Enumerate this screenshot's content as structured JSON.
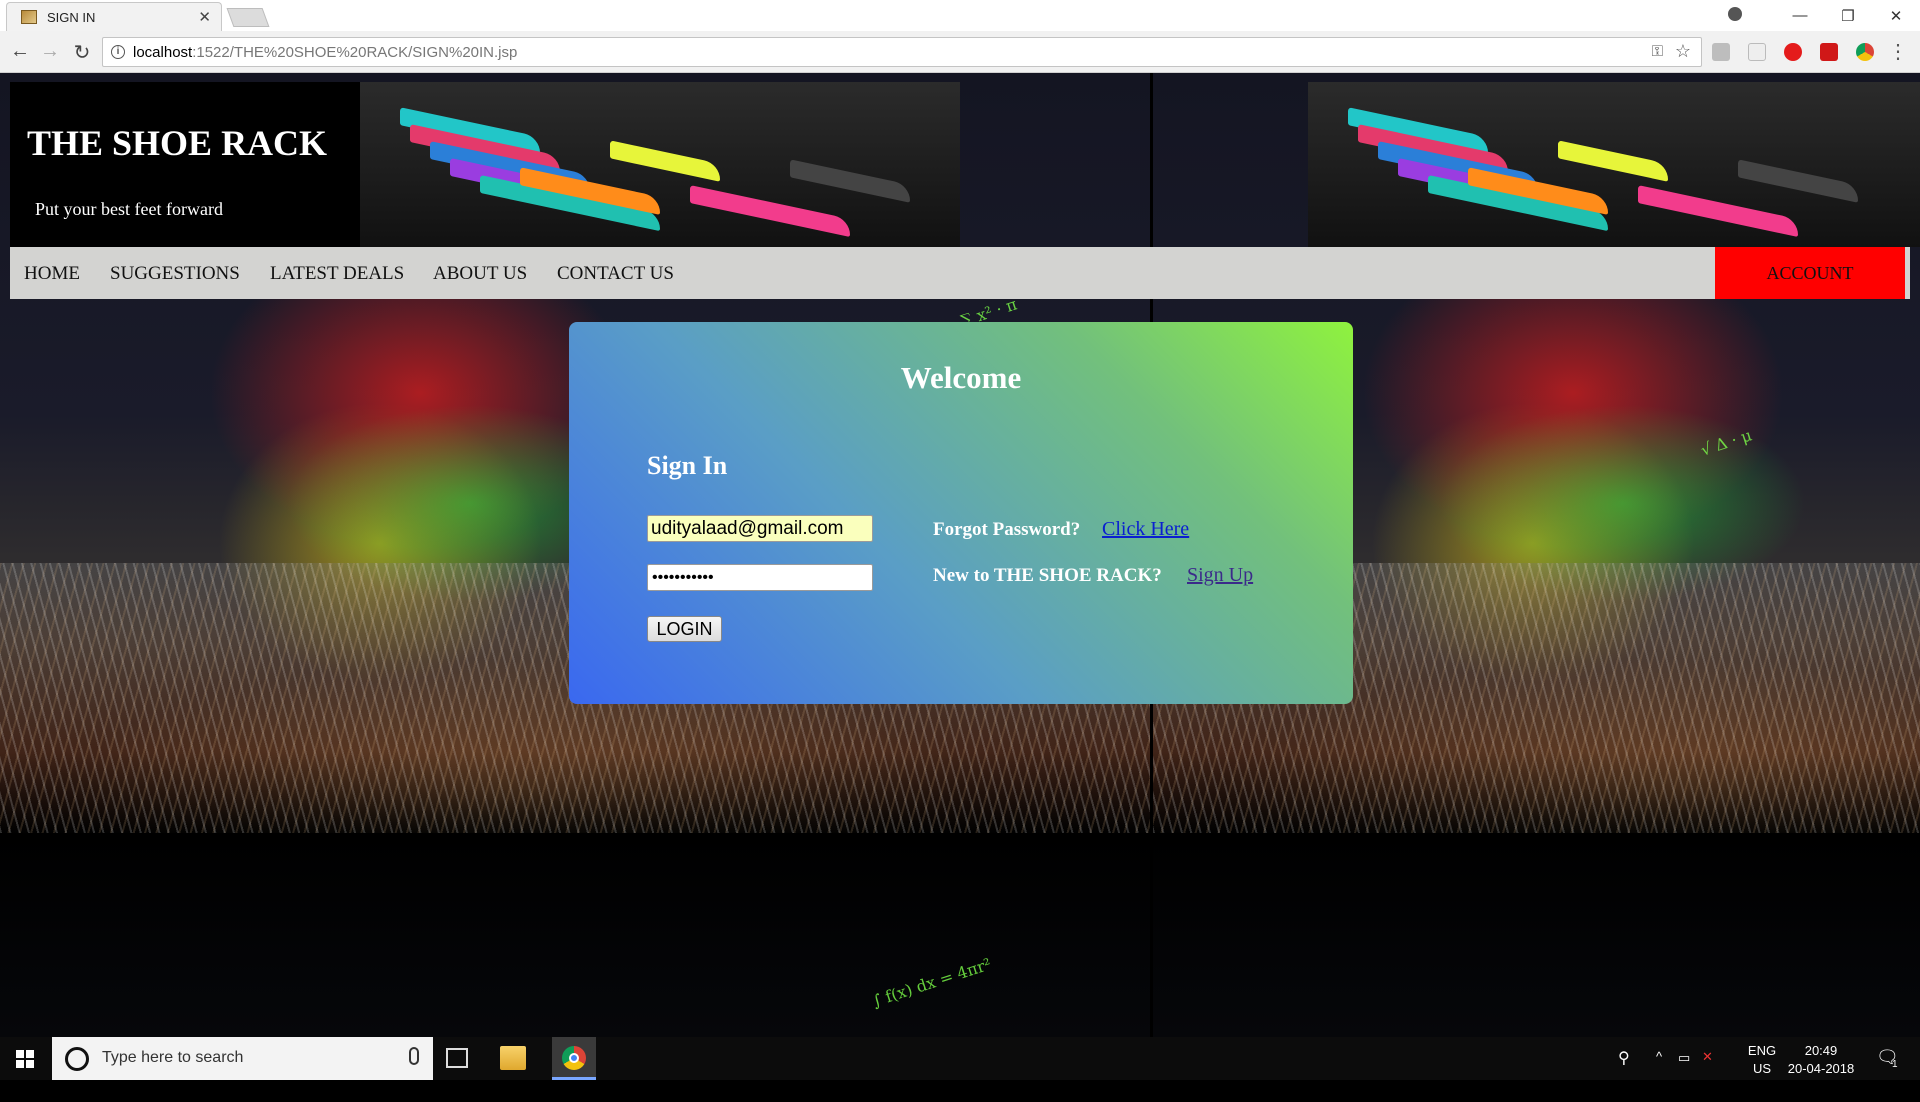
{
  "browser": {
    "tab_title": "SIGN IN",
    "url_host": "localhost",
    "url_path": ":1522/THE%20SHOE%20RACK/SIGN%20IN.jsp"
  },
  "site": {
    "title": "THE SHOE RACK",
    "tagline": "Put your best feet forward"
  },
  "nav": {
    "items": [
      "HOME",
      "SUGGESTIONS",
      "LATEST DEALS",
      "ABOUT US",
      "CONTACT US"
    ],
    "account": "ACCOUNT"
  },
  "login": {
    "welcome": "Welcome",
    "heading": "Sign In",
    "email_value": "udityalaad@gmail.com",
    "password_value": "•••••••••••",
    "login_button": "LOGIN",
    "forgot_label": "Forgot Password?",
    "forgot_link": "Click Here",
    "new_label": "New to THE SHOE RACK?",
    "signup_link": "Sign Up"
  },
  "taskbar": {
    "search_placeholder": "Type here to search",
    "lang_line1": "ENG",
    "lang_line2": "US",
    "time": "20:49",
    "date": "20-04-2018",
    "notification_count": "1"
  },
  "colors": {
    "account_bg": "#ff0000",
    "navbar_bg": "#d3d3d1",
    "link_forgot": "#0a1fd0",
    "link_signup": "#3b2a8a",
    "card_gradient_start": "#3a68f0",
    "card_gradient_end": "#8ff23e"
  }
}
